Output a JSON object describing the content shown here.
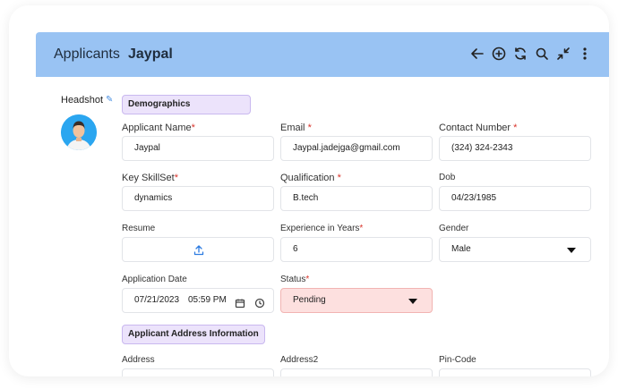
{
  "header": {
    "title": "Applicants",
    "record_name": "Jaypal",
    "icons": [
      "back-arrow-icon",
      "add-circle-icon",
      "refresh-icon",
      "search-icon",
      "collapse-icon",
      "more-vertical-icon"
    ]
  },
  "headshot": {
    "label": "Headshot"
  },
  "sections": {
    "demographics": "Demographics",
    "address": "Applicant Address Information"
  },
  "fields": {
    "applicant_name": {
      "label": "Applicant Name",
      "value": "Jaypal",
      "required": "*"
    },
    "email": {
      "label": "Email",
      "value": "Jaypal.jadejga@gmail.com",
      "required": "*"
    },
    "contact_number": {
      "label": "Contact Number",
      "value": "(324) 324-2343",
      "required": "*"
    },
    "key_skillset": {
      "label": "Key SkillSet",
      "value": "dynamics",
      "required": "*"
    },
    "qualification": {
      "label": "Qualification",
      "value": "B.tech",
      "required": "*"
    },
    "dob": {
      "label": "Dob",
      "value": "04/23/1985"
    },
    "resume": {
      "label": "Resume"
    },
    "experience": {
      "label": "Experience in Years",
      "value": "6",
      "required": "*"
    },
    "gender": {
      "label": "Gender",
      "value": "Male"
    },
    "application_date": {
      "label": "Application Date",
      "date": "07/21/2023",
      "time": "05:59 PM"
    },
    "status": {
      "label": "Status",
      "value": "Pending",
      "required": "*"
    },
    "address": {
      "label": "Address"
    },
    "address2": {
      "label": "Address2"
    },
    "pincode": {
      "label": "Pin-Code"
    }
  },
  "colors": {
    "header_bg": "#99c3f3",
    "status_bg": "#fde0df",
    "section_tag_bg": "#ece3fb",
    "required": "#d9342b"
  }
}
